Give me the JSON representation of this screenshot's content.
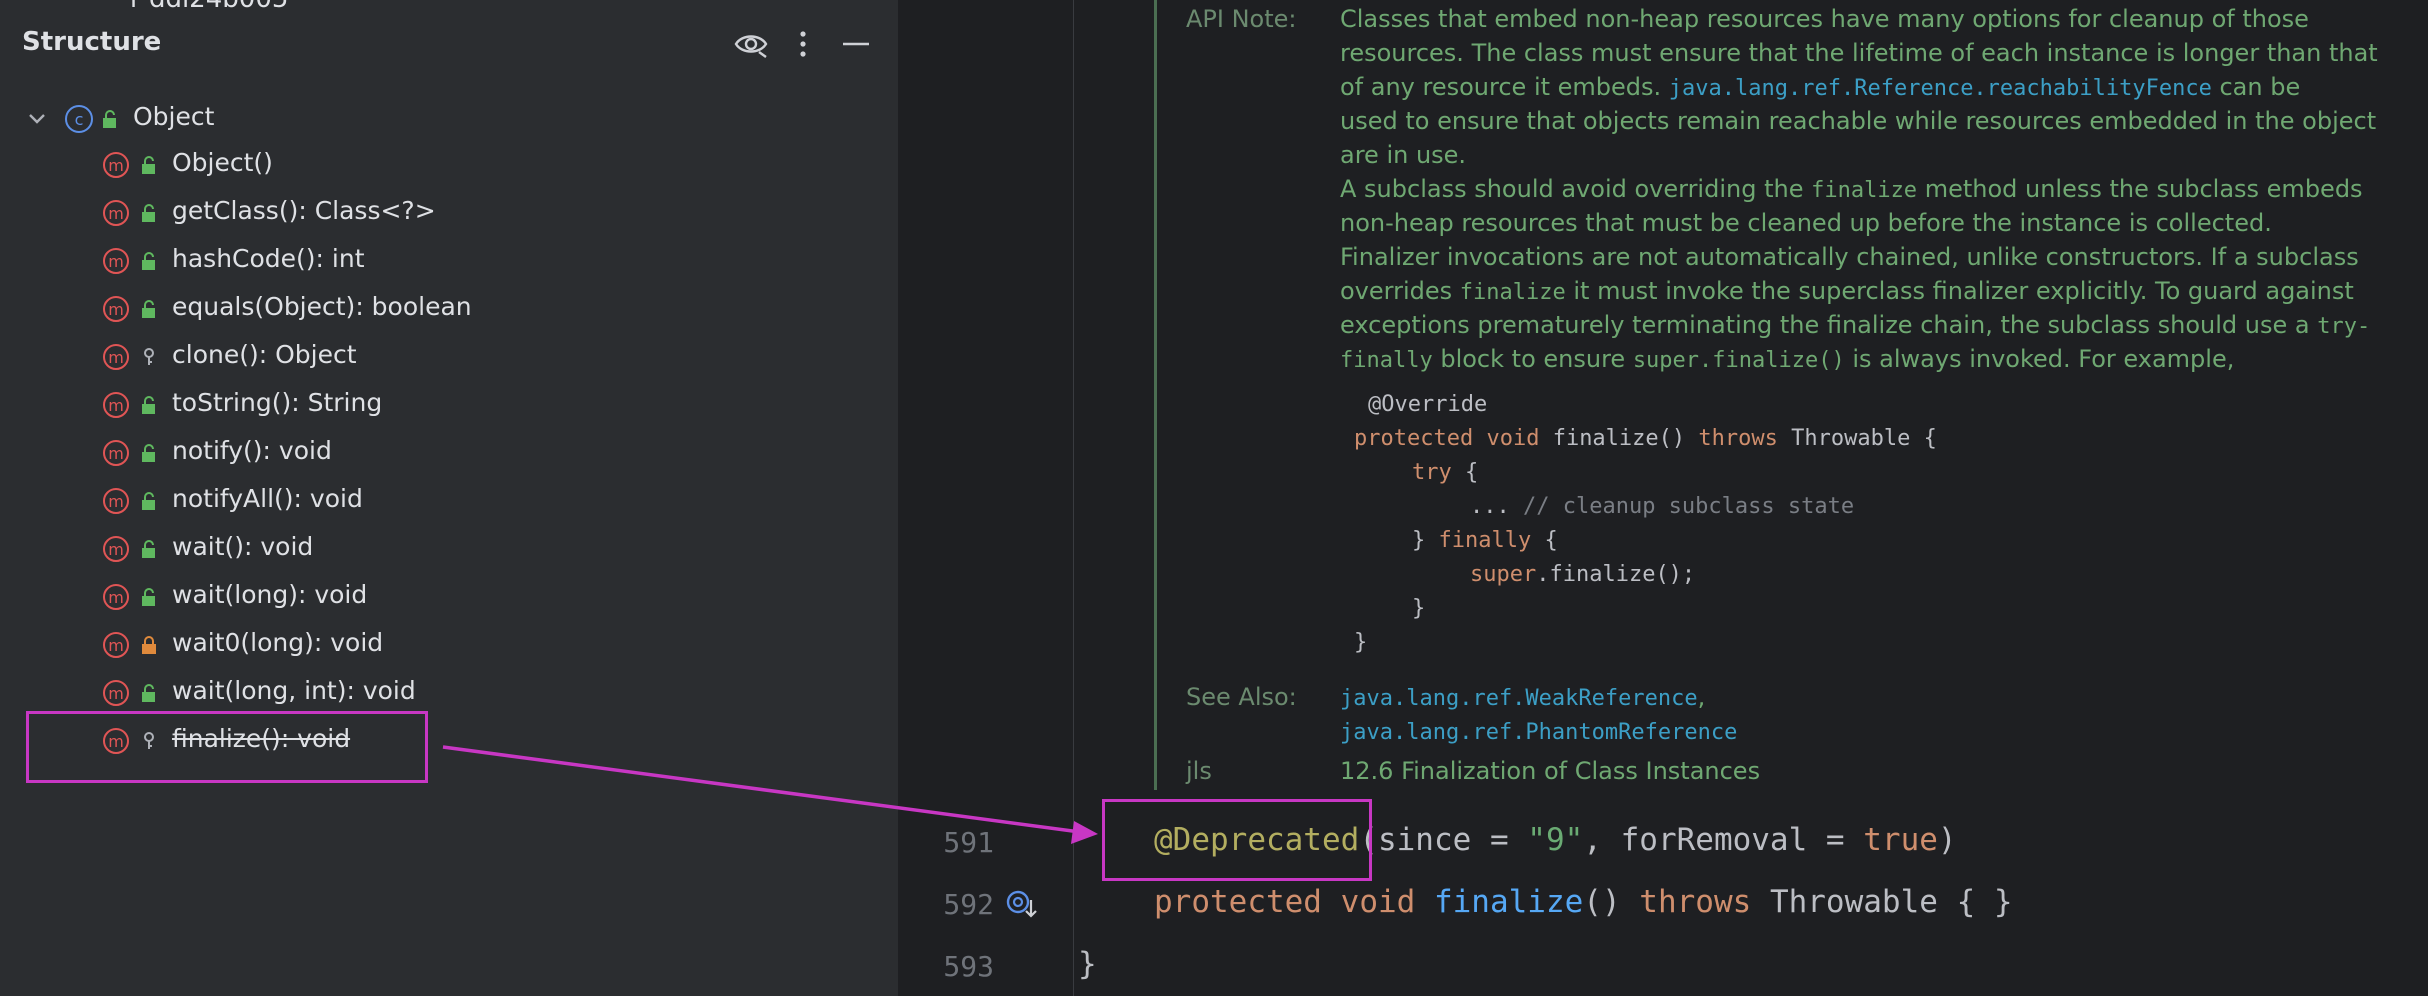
{
  "structure": {
    "title": "Structure",
    "cut_off_text": "r ddl24b005",
    "root": {
      "label": "Object",
      "badge": "c"
    },
    "members": [
      {
        "label": "Object()",
        "visibility": "public"
      },
      {
        "label": "getClass(): Class<?>",
        "visibility": "public"
      },
      {
        "label": "hashCode(): int",
        "visibility": "public"
      },
      {
        "label": "equals(Object): boolean",
        "visibility": "public"
      },
      {
        "label": "clone(): Object",
        "visibility": "protected"
      },
      {
        "label": "toString(): String",
        "visibility": "public"
      },
      {
        "label": "notify(): void",
        "visibility": "public"
      },
      {
        "label": "notifyAll(): void",
        "visibility": "public"
      },
      {
        "label": "wait(): void",
        "visibility": "public"
      },
      {
        "label": "wait(long): void",
        "visibility": "public"
      },
      {
        "label": "wait0(long): void",
        "visibility": "private"
      },
      {
        "label": "wait(long, int): void",
        "visibility": "public"
      },
      {
        "label": "finalize(): void",
        "visibility": "protected",
        "deprecated": true
      }
    ],
    "icons": [
      "eye-icon",
      "more-vertical-icon",
      "minimize-icon"
    ]
  },
  "doc": {
    "api_note_label": "API Note:",
    "p1": {
      "a": "Classes that embed non-heap resources have many options for cleanup of those",
      "b": "resources. The class must ensure that the lifetime of each instance is longer than that",
      "c1": "of any resource it embeds. ",
      "c_link": "java.lang.ref.Reference.reachabilityFence",
      "c2": " can be",
      "d": "used to ensure that objects remain reachable while resources embedded in the object",
      "e": "are in use."
    },
    "p2": {
      "a1": "A subclass should avoid overriding the ",
      "a_code": "finalize",
      "a2": " method unless the subclass embeds",
      "b": "non-heap resources that must be cleaned up before the instance is collected.",
      "c": "Finalizer invocations are not automatically chained, unlike constructors. If a subclass",
      "d1": "overrides ",
      "d_code": "finalize",
      "d2": " it must invoke the superclass finalizer explicitly. To guard against",
      "e1": "exceptions prematurely terminating the finalize chain, the subclass should use a ",
      "e_code": "try-",
      "f_code": "finally",
      "f1": " block to ensure ",
      "f_code2": "super.finalize()",
      "f2": " is always invoked. For example,"
    },
    "example": {
      "l1": "@Override",
      "l2_kw1": "protected",
      "l2_kw2": "void",
      "l2_a": " finalize() ",
      "l2_kw3": "throws",
      "l2_b": " Throwable {",
      "l3_kw": "try",
      "l3_b": " {",
      "l4_a": "... ",
      "l4_cm": "// cleanup subclass state",
      "l5_a": "} ",
      "l5_kw": "finally",
      "l5_b": " {",
      "l6_kw": "super",
      "l6_b": ".finalize();",
      "l7": "}",
      "l8": "}"
    },
    "see_also_label": "See Also:",
    "see_also_1": "java.lang.ref.WeakReference",
    "see_also_1_comma": ",",
    "see_also_2": "java.lang.ref.PhantomReference",
    "jls_label": "jls",
    "jls_text": "12.6 Finalization of Class Instances"
  },
  "code": {
    "lines": [
      {
        "num": "591",
        "ann": "@Deprecated",
        "p1": "(since = ",
        "str": "\"9\"",
        "p2": ", forRemoval = ",
        "kw": "true",
        "p3": ")"
      },
      {
        "num": "592",
        "kw1": "protected",
        "sp1": " ",
        "kw2": "void",
        "sp2": " ",
        "fn": "finalize",
        "p1": "() ",
        "kw3": "throws",
        "p2": " Throwable { }"
      },
      {
        "num": "593",
        "text": "}"
      }
    ]
  },
  "colors": {
    "accent_highlight": "#c837c4",
    "method_badge": "#e05555",
    "class_badge": "#5c8fe6",
    "public_lock": "#5fb85f",
    "private_lock": "#e08a3c"
  }
}
